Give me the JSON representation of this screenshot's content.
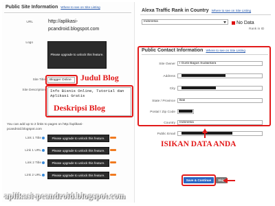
{
  "left": {
    "title": "Public Site Information",
    "where_link": "Where to see on Site Listing",
    "url_label": "URL",
    "url_value_line1": "http://aplikasi-",
    "url_value_line2": "pcandroid.blogspot.com",
    "logo_label": "Logo",
    "logo_msg": "Please upgrade to unlock this feature.",
    "site_title_label": "Site Title",
    "site_title_value": "Blogger Online",
    "site_desc_label": "Site Description",
    "site_desc_value": "Info Bisnis Online, Tutorial dan Aplikasi Gratis",
    "links_note_line1": "You can add up to 2 links to pages on http://aplikasi-",
    "links_note_line2": "pcandroid.blogspot.com",
    "links": [
      {
        "label": "Link 1 Title",
        "msg": "Please upgrade to unlock this feature."
      },
      {
        "label": "Link 1 URL",
        "msg": "Please upgrade to unlock this feature."
      },
      {
        "label": "Link 2 Title",
        "msg": "Please upgrade to unlock this feature."
      },
      {
        "label": "Link 2 URL",
        "msg": "Please upgrade to unlock this feature."
      }
    ]
  },
  "right": {
    "alexa_title": "Alexa Traffic Rank in Country",
    "alexa_where": "Where to see on Site Listing",
    "country_select": "Indonesia",
    "no_data": "No Data",
    "rank_label": "Rank in ID",
    "contact_title": "Public Contact Information",
    "contact_where": "Where to see on Site Listing",
    "fields": [
      {
        "label": "Site Owner",
        "value": "I Gusti Bagus Sudiantara",
        "redacted": false
      },
      {
        "label": "Address",
        "value": "",
        "redacted": true
      },
      {
        "label": "City",
        "value": "",
        "redacted": true
      },
      {
        "label": "State / Province",
        "value": "Bali",
        "redacted": false
      },
      {
        "label": "Postal / Zip Code",
        "value": "",
        "redacted": true
      },
      {
        "label": "Country",
        "value": "Indonesia",
        "redacted": false
      },
      {
        "label": "Public Email",
        "value": "",
        "redacted": true
      }
    ],
    "save_button": "Save & Continue",
    "skip_button": "Skip"
  },
  "annotations": {
    "judul": "Judul Blog",
    "deskripsi": "Deskripsi Blog",
    "isikan": "ISIKAN DATA ANDA"
  },
  "watermark": "aplikasi-pcandroid.blogspot.com",
  "colors": {
    "annotation_red": "#e21818",
    "save_blue": "#2a66c4",
    "upgrade_orange": "#f07a20"
  }
}
